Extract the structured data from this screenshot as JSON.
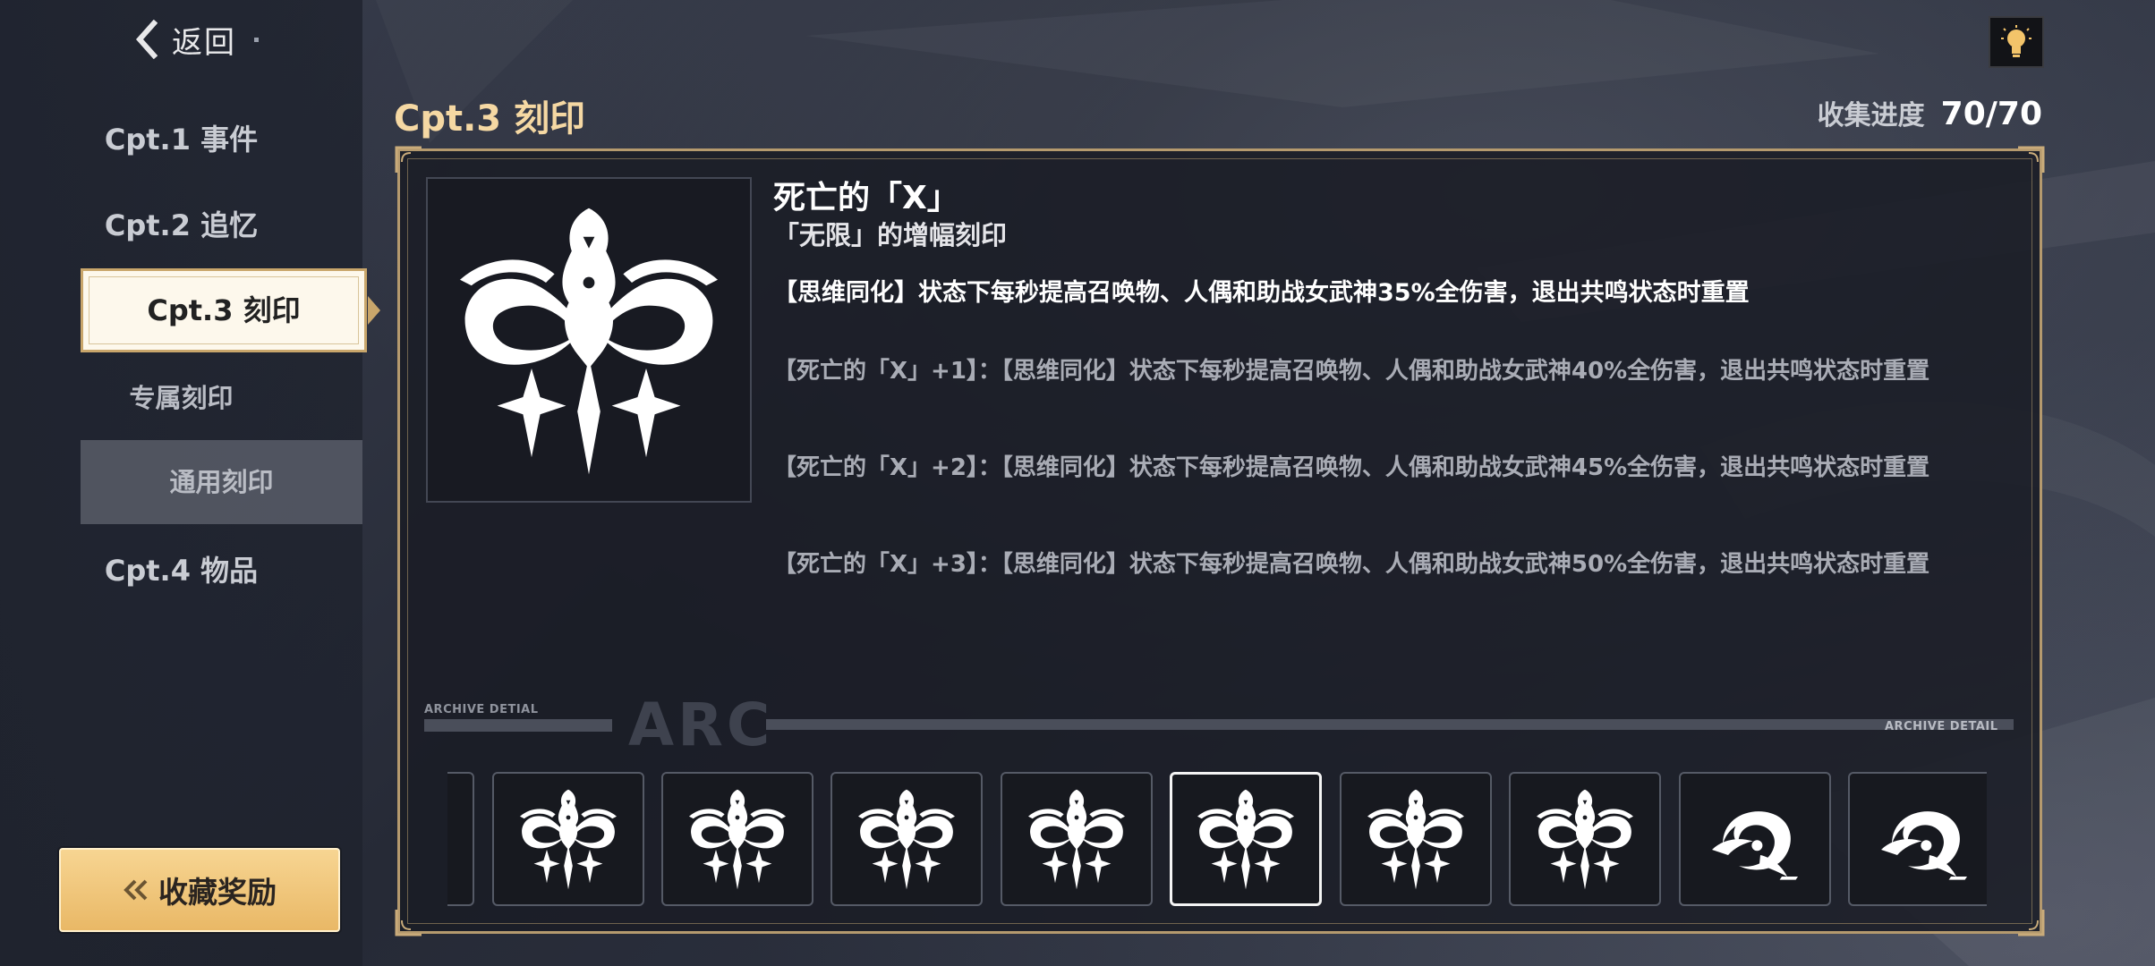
{
  "nav": {
    "back_label": "返回",
    "items": [
      {
        "label": "Cpt.1 事件"
      },
      {
        "label": "Cpt.2 追忆"
      },
      {
        "label": "Cpt.3 刻印"
      },
      {
        "label": "专属刻印"
      },
      {
        "label": "通用刻印"
      },
      {
        "label": "Cpt.4 物品"
      }
    ],
    "reward_label": "收藏奖励"
  },
  "header": {
    "title": "Cpt.3 刻印",
    "progress_label": "收集进度",
    "progress_value": "70/70"
  },
  "detail": {
    "name": "死亡的「X」",
    "subtitle": "「无限」的增幅刻印",
    "effect": "【思维同化】状态下每秒提高召唤物、人偶和助战女武神35%全伤害，退出共鸣状态时重置",
    "upgrades": [
      "【死亡的「X」+1】：【思维同化】状态下每秒提高召唤物、人偶和助战女武神40%全伤害，退出共鸣状态时重置",
      "【死亡的「X」+2】：【思维同化】状态下每秒提高召唤物、人偶和助战女武神45%全伤害，退出共鸣状态时重置",
      "【死亡的「X」+3】：【思维同化】状态下每秒提高召唤物、人偶和助战女武神50%全伤害，退出共鸣状态时重置"
    ]
  },
  "archive": {
    "label_left": "ARCHIVE DETIAL",
    "watermark": "ARC",
    "label_right": "ARCHIVE DETAIL"
  },
  "thumbnails": [
    {
      "icon": "serpent-sigil-icon"
    },
    {
      "icon": "serpent-sigil-icon"
    },
    {
      "icon": "serpent-sigil-icon"
    },
    {
      "icon": "serpent-sigil-icon"
    },
    {
      "icon": "serpent-sigil-icon"
    },
    {
      "icon": "serpent-sigil-icon",
      "selected": true
    },
    {
      "icon": "serpent-sigil-icon"
    },
    {
      "icon": "serpent-sigil-icon"
    },
    {
      "icon": "swirl-orb-icon"
    },
    {
      "icon": "swirl-orb-icon"
    }
  ],
  "colors": {
    "accent_gold": "#f5d8a3",
    "panel_border": "#b59a6e",
    "reward_button": "#efc57a"
  }
}
